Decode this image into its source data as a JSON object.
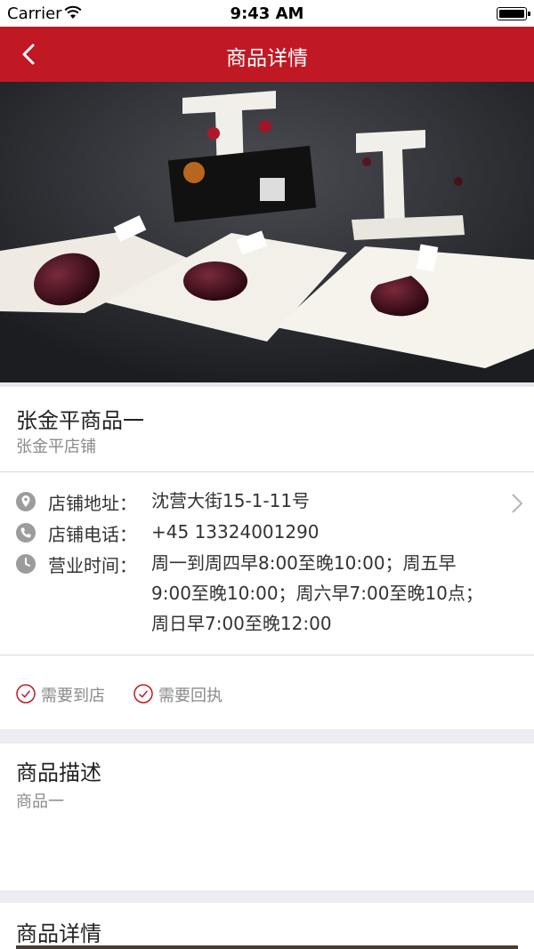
{
  "status_bar": {
    "carrier": "Carrier",
    "time": "9:43 AM"
  },
  "nav": {
    "title": "商品详情"
  },
  "product": {
    "name": "张金平商品一",
    "shop": "张金平店铺"
  },
  "store_info": {
    "address_label": "店铺地址：",
    "address": "沈营大街15-1-11号",
    "phone_label": "店铺电话：",
    "phone": "+45 13324001290",
    "hours_label": "营业时间：",
    "hours_line1": "周一到周四早8:00至晚10:00；周五早",
    "hours_line2": "9:00至晚10:00；周六早7:00至晚10点；",
    "hours_line3": "周日早7:00至晚12:00"
  },
  "tags": [
    "需要到店",
    "需要回执"
  ],
  "description": {
    "heading": "商品描述",
    "body": "商品一"
  },
  "details": {
    "heading": "商品详情"
  },
  "colors": {
    "brand_red": "#c01924",
    "separator": "#ececf2",
    "muted_text": "#8a8a8a"
  }
}
